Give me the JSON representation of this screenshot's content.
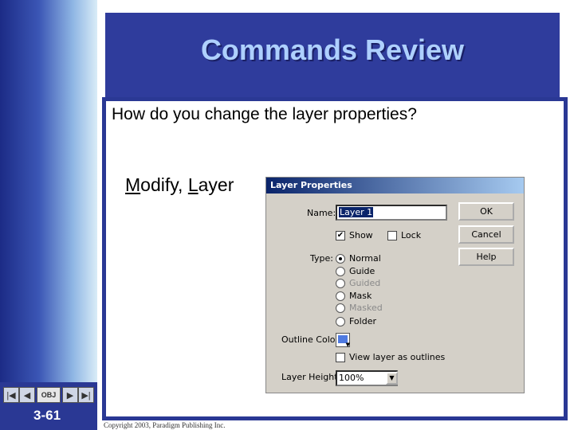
{
  "slide": {
    "title": "Commands Review",
    "question": "How do you change the layer properties?",
    "answer": {
      "first_letter_1": "M",
      "rest_1": "odify, ",
      "first_letter_2": "L",
      "rest_2": "ayer"
    },
    "copyright": "Copyright 2003, Paradigm Publishing Inc.",
    "slide_number": "3-61",
    "nav": {
      "obj_label": "OBJ",
      "first_glyph": "|◀",
      "prev_glyph": "◀",
      "next_glyph": "▶",
      "last_glyph": "▶|"
    }
  },
  "dialog": {
    "title": "Layer Properties",
    "name_label": "Name:",
    "name_value": "Layer 1",
    "ok_label": "OK",
    "cancel_label": "Cancel",
    "help_label": "Help",
    "show_label": "Show",
    "show_checked": true,
    "lock_label": "Lock",
    "lock_checked": false,
    "type_label": "Type:",
    "types": [
      {
        "label": "Normal",
        "selected": true,
        "enabled": true
      },
      {
        "label": "Guide",
        "selected": false,
        "enabled": true
      },
      {
        "label": "Guided",
        "selected": false,
        "enabled": false
      },
      {
        "label": "Mask",
        "selected": false,
        "enabled": true
      },
      {
        "label": "Masked",
        "selected": false,
        "enabled": false
      },
      {
        "label": "Folder",
        "selected": false,
        "enabled": true
      }
    ],
    "outline_color_label": "Outline Color:",
    "outline_color": "#4f7ae0",
    "view_outline_label": "View layer as outlines",
    "view_outline_checked": false,
    "layer_height_label": "Layer Height:",
    "layer_height_value": "100%"
  }
}
